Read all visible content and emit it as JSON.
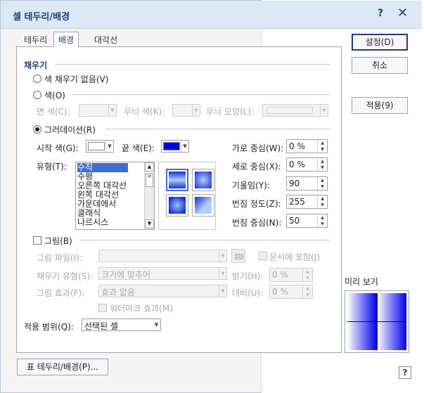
{
  "dialog": {
    "title": "셀 테두리/배경",
    "help": "?",
    "close": "✕"
  },
  "tabs": [
    {
      "label": "테두리"
    },
    {
      "label": "배경"
    },
    {
      "label": "대각선"
    }
  ],
  "fill": {
    "group_label": "채우기",
    "no_fill": "색 채우기 없음(V)",
    "color": "색(O)",
    "face_color": "면 색(C):",
    "pattern_color": "무늬 색(K):",
    "pattern_shape": "무늬 모양(L):",
    "gradation": "그러데이션(R)"
  },
  "gradation": {
    "start_color": "시작 색(G):",
    "end_color": "끝 색(E):",
    "start_swatch": "#ffffff",
    "end_swatch": "#0000ee",
    "type_label": "유형(T):",
    "types": [
      "수직",
      "수평",
      "오른쪽 대각선",
      "왼쪽 대각선",
      "가운데에서",
      "클래식",
      "나르시스"
    ],
    "selected_type": "수직",
    "h_center_label": "가로 중심(W):",
    "h_center_value": "0 %",
    "v_center_label": "세로 중심(X):",
    "v_center_value": "0 %",
    "tilt_label": "기울임(Y):",
    "tilt_value": "90",
    "blur_label": "번짐 정도(Z):",
    "blur_value": "255",
    "blur_center_label": "번짐 중심(N):",
    "blur_center_value": "50"
  },
  "picture": {
    "label": "그림(B)",
    "file_label": "그림 파일(I):",
    "include_doc": "문서에 포함(J)",
    "fill_type_label": "채우기 유형(S):",
    "fill_type_value": "크기에 맞추어",
    "brightness_label": "밝기(H):",
    "brightness_value": "0 %",
    "effect_label": "그림 효과(F):",
    "effect_value": "효과 없음",
    "contrast_label": "대비(U):",
    "contrast_value": "0 %",
    "watermark": "워터마크 효과(M)"
  },
  "scope": {
    "label": "적용 범위(Q):",
    "value": "선택된 셀"
  },
  "buttons": {
    "ok": "설정(D)",
    "cancel": "취소",
    "apply": "적용(9)",
    "table_border": "표 테두리/배경(P)..."
  },
  "preview": {
    "label": "미리 보기"
  },
  "colors": {
    "accent": "#1f3e7a",
    "selection": "#3c6fd0",
    "gradient_blue": "#0000ee"
  }
}
